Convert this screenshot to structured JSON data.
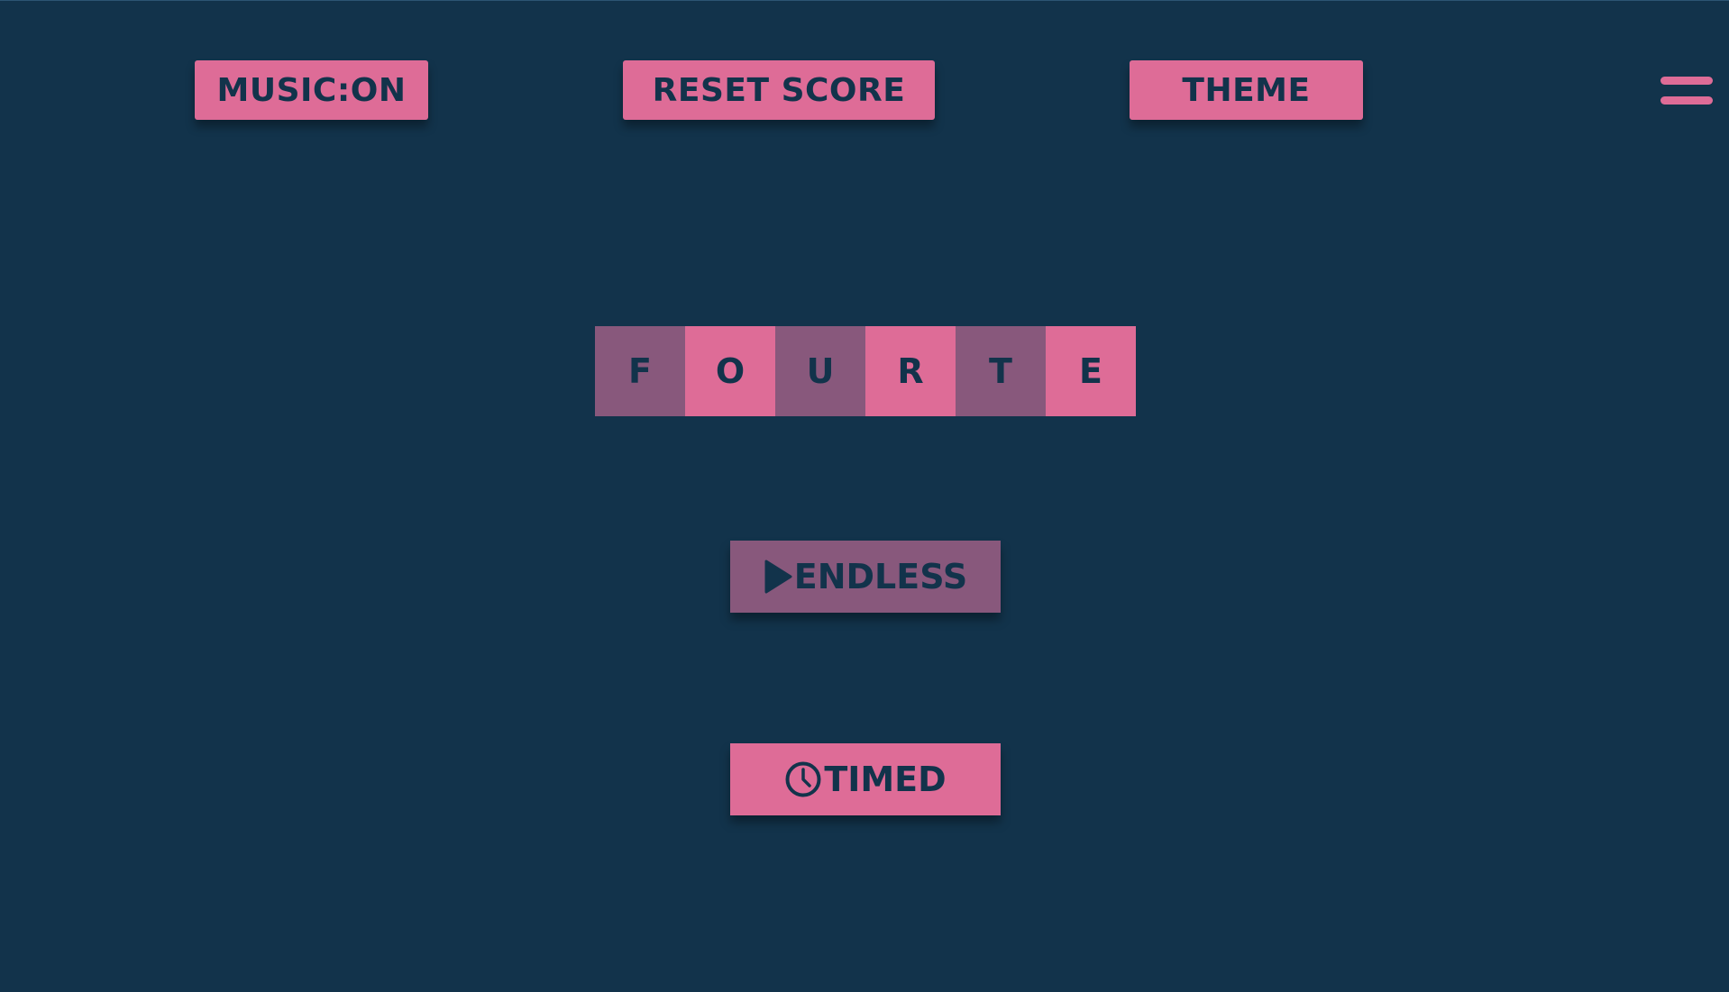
{
  "toolbar": {
    "music_label": "MUSIC:ON",
    "reset_label": "RESET SCORE",
    "theme_label": "THEME",
    "menu_icon": "hamburger-menu-icon"
  },
  "title": {
    "letters": [
      "F",
      "O",
      "U",
      "R",
      "T",
      "E"
    ]
  },
  "modes": {
    "endless": {
      "label": "ENDLESS",
      "icon": "play-icon"
    },
    "timed": {
      "label": "TIMED",
      "icon": "clock-icon"
    }
  },
  "colors": {
    "background": "#12334b",
    "accent_pink": "#de6c97",
    "muted_pink": "#88587c",
    "text_dark": "#12334b"
  }
}
